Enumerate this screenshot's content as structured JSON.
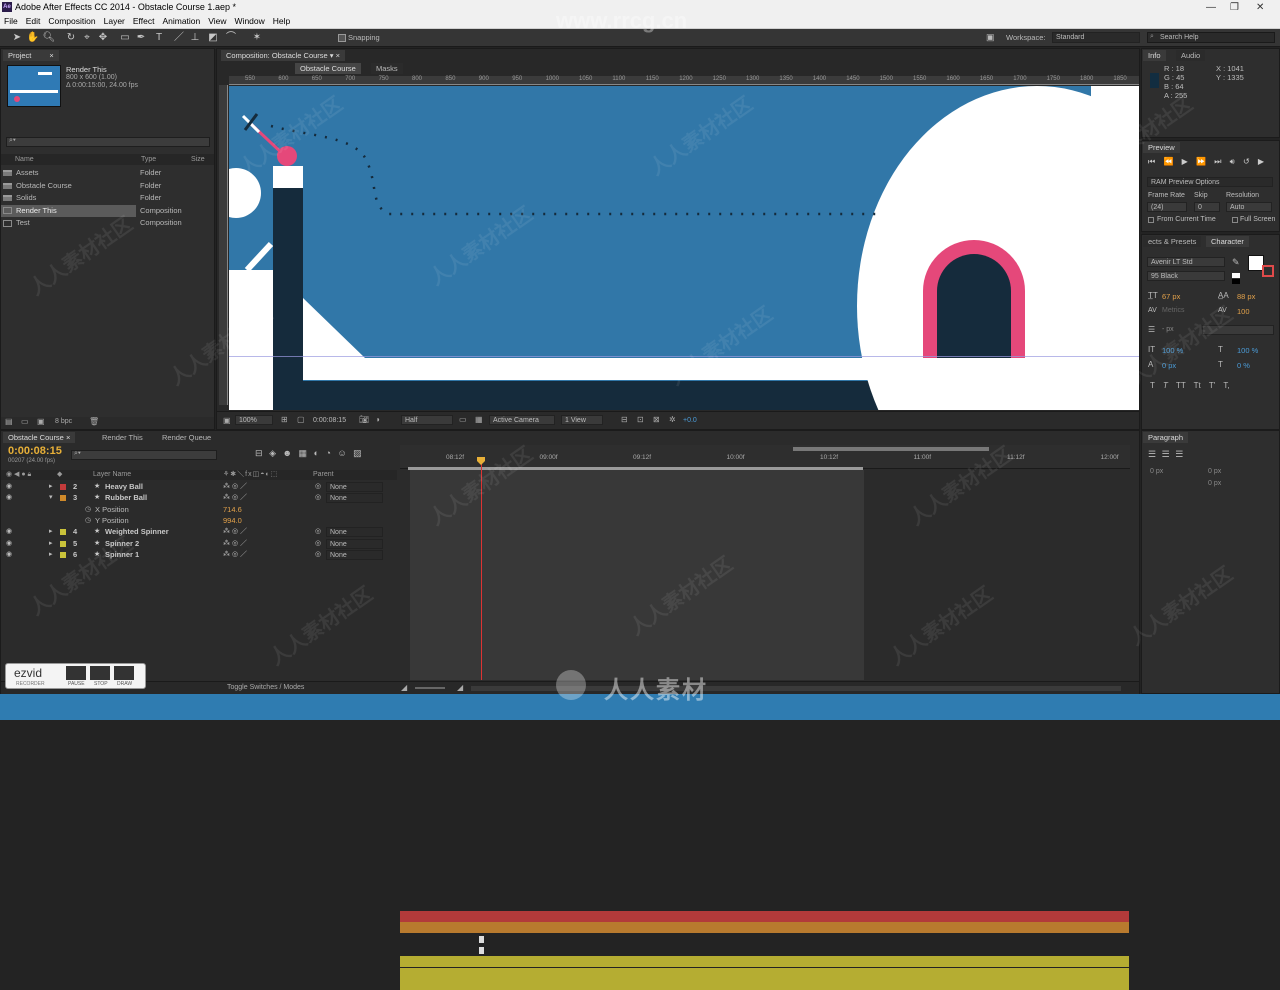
{
  "app": {
    "title": "Adobe After Effects CC 2014 - Obstacle Course 1.aep *",
    "logo": "Ae"
  },
  "menu": [
    "File",
    "Edit",
    "Composition",
    "Layer",
    "Effect",
    "Animation",
    "View",
    "Window",
    "Help"
  ],
  "toolbar": {
    "snapping_label": "Snapping",
    "workspace_label": "Workspace:",
    "workspace_value": "Standard",
    "search_placeholder": "Search Help"
  },
  "project": {
    "tab": "Project",
    "selected_name": "Render This",
    "selected_dims": "800 x 600 (1.00)",
    "selected_duration": "Δ 0:00:15:00, 24.00 fps",
    "search_placeholder": "",
    "col_name": "Name",
    "col_type": "Type",
    "col_size": "Size",
    "items": [
      {
        "name": "Assets",
        "type": "Folder",
        "kind": "folder"
      },
      {
        "name": "Obstacle Course",
        "type": "Folder",
        "kind": "folder"
      },
      {
        "name": "Solids",
        "type": "Folder",
        "kind": "folder"
      },
      {
        "name": "Render This",
        "type": "Composition",
        "kind": "comp",
        "selected": true
      },
      {
        "name": "Test",
        "type": "Composition",
        "kind": "comp"
      }
    ],
    "bpc": "8 bpc"
  },
  "composition": {
    "panel_tab": "Composition: Obstacle Course",
    "sub_tabs": [
      "Obstacle Course",
      "Masks"
    ],
    "ruler_ticks": [
      "550",
      "600",
      "650",
      "700",
      "750",
      "800",
      "850",
      "900",
      "950",
      "1000",
      "1050",
      "1100",
      "1150",
      "1200",
      "1250",
      "1300",
      "1350",
      "1400",
      "1450",
      "1500",
      "1550",
      "1600",
      "1650",
      "1700",
      "1750",
      "1800",
      "1850",
      "1900",
      "1950"
    ],
    "zoom": "100%",
    "timecode": "0:00:08:15",
    "resolution": "Half",
    "camera": "Active Camera",
    "views": "1 View",
    "exposure": "+0.0",
    "colors": {
      "sky": "#3177a8",
      "white": "#ffffff",
      "dark": "#152b3c",
      "pink": "#e5487a"
    }
  },
  "info": {
    "tabs": [
      "Info",
      "Audio"
    ],
    "r": "R : 18",
    "g": "G : 45",
    "b": "B : 64",
    "a": "A : 255",
    "x": "X : 1041",
    "y": "Y : 1335"
  },
  "preview": {
    "tab": "Preview",
    "ram_options": "RAM Preview Options",
    "frame_rate_label": "Frame Rate",
    "skip_label": "Skip",
    "resolution_label": "Resolution",
    "frame_rate": "(24)",
    "skip": "0",
    "resolution": "Auto",
    "from_current": "From Current Time",
    "full_screen": "Full Screen"
  },
  "character": {
    "tabs": [
      "ects & Presets",
      "Character"
    ],
    "font": "Avenir LT Std",
    "style": "95 Black",
    "size": "67 px",
    "leading": "88 px",
    "kerning": "Metrics",
    "tracking": "100",
    "stroke_unit": "- px",
    "v_scale": "100 %",
    "h_scale": "100 %",
    "baseline": "0 px",
    "tsume": "0 %",
    "styles": [
      "T",
      "T",
      "TT",
      "Tt",
      "T'",
      "T,"
    ]
  },
  "paragraph": {
    "tab": "Paragraph",
    "indent": "0 px",
    "space": "0 px"
  },
  "timeline": {
    "tabs": [
      "Obstacle Course",
      "Render This",
      "Render Queue"
    ],
    "timecode": "0:00:08:15",
    "fps_info": "00207 (24.00 fps)",
    "col_layer_name": "Layer Name",
    "col_parent": "Parent",
    "ruler": [
      "08:12f",
      "09:00f",
      "09:12f",
      "10:00f",
      "10:12f",
      "11:00f",
      "11:12f",
      "12:00f"
    ],
    "layers": [
      {
        "num": "2",
        "name": "Heavy Ball",
        "parent": "None",
        "color": "#c43b3b",
        "bar": "#b23a3a"
      },
      {
        "num": "3",
        "name": "Rubber Ball",
        "parent": "None",
        "color": "#d08a2a",
        "bar": "#b87a2e"
      },
      {
        "num": "4",
        "name": "Weighted Spinner",
        "parent": "None",
        "color": "#c9c23a",
        "bar": "#b5ad32"
      },
      {
        "num": "5",
        "name": "Spinner 2",
        "parent": "None",
        "color": "#c9c23a",
        "bar": "#b5ad32"
      },
      {
        "num": "6",
        "name": "Spinner 1",
        "parent": "None",
        "color": "#c9c23a",
        "bar": "#b5ad32"
      }
    ],
    "properties": [
      {
        "name": "X Position",
        "value": "714.6"
      },
      {
        "name": "Y Position",
        "value": "994.0"
      }
    ],
    "toggle_label": "Toggle Switches / Modes"
  },
  "ezvid": {
    "logo": "ezvid",
    "sub": "RECORDER",
    "pause": "PAUSE",
    "stop": "STOP",
    "draw": "DRAW"
  },
  "watermark": {
    "top": "www.rrcg.cn",
    "bottom": "人人素材",
    "repeat": "人人素材社区"
  }
}
